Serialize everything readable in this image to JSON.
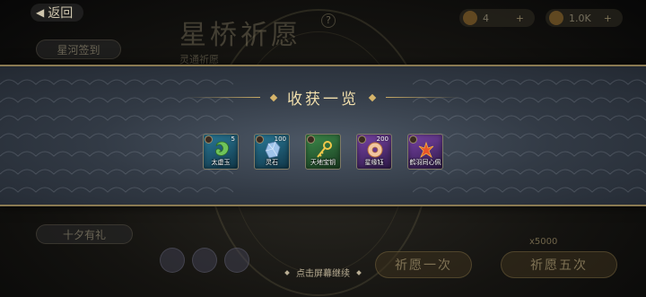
{
  "background": {
    "back_label": "返回",
    "title": "星桥祈愿",
    "subtitle": "灵通祈愿",
    "help_mark": "?",
    "currencies": [
      {
        "icon": "gem-currency-icon",
        "value": "4"
      },
      {
        "icon": "coin-currency-icon",
        "value": "1.0K"
      }
    ],
    "side_tabs": [
      {
        "label": "星河签到"
      },
      {
        "label": "十夕有礼"
      }
    ],
    "bottom_buttons": [
      {
        "label": "祈愿一次"
      },
      {
        "label": "祈愿五次"
      }
    ],
    "bottom_price": "x5000"
  },
  "panel": {
    "title": "收获一览",
    "items": [
      {
        "name": "太虚玉",
        "count": "5",
        "quality": "blue",
        "icon": "jade-icon"
      },
      {
        "name": "灵石",
        "count": "100",
        "quality": "blue",
        "icon": "spirit-stone-icon"
      },
      {
        "name": "天地宝钥",
        "count": "",
        "quality": "green",
        "icon": "golden-key-icon"
      },
      {
        "name": "星缘钰",
        "count": "200",
        "quality": "purple",
        "icon": "jade-ring-icon"
      },
      {
        "name": "鹤羽同心佩",
        "count": "",
        "quality": "purple",
        "icon": "feather-pendant-icon"
      }
    ]
  },
  "footer": {
    "continue_text": "点击屏幕继续"
  },
  "colors": {
    "panel_border": "#8a7a52",
    "title_gold": "#f1dfac",
    "quality_blue": "#2a7a98",
    "quality_green": "#3d8a4a",
    "quality_purple": "#7a44a8"
  }
}
